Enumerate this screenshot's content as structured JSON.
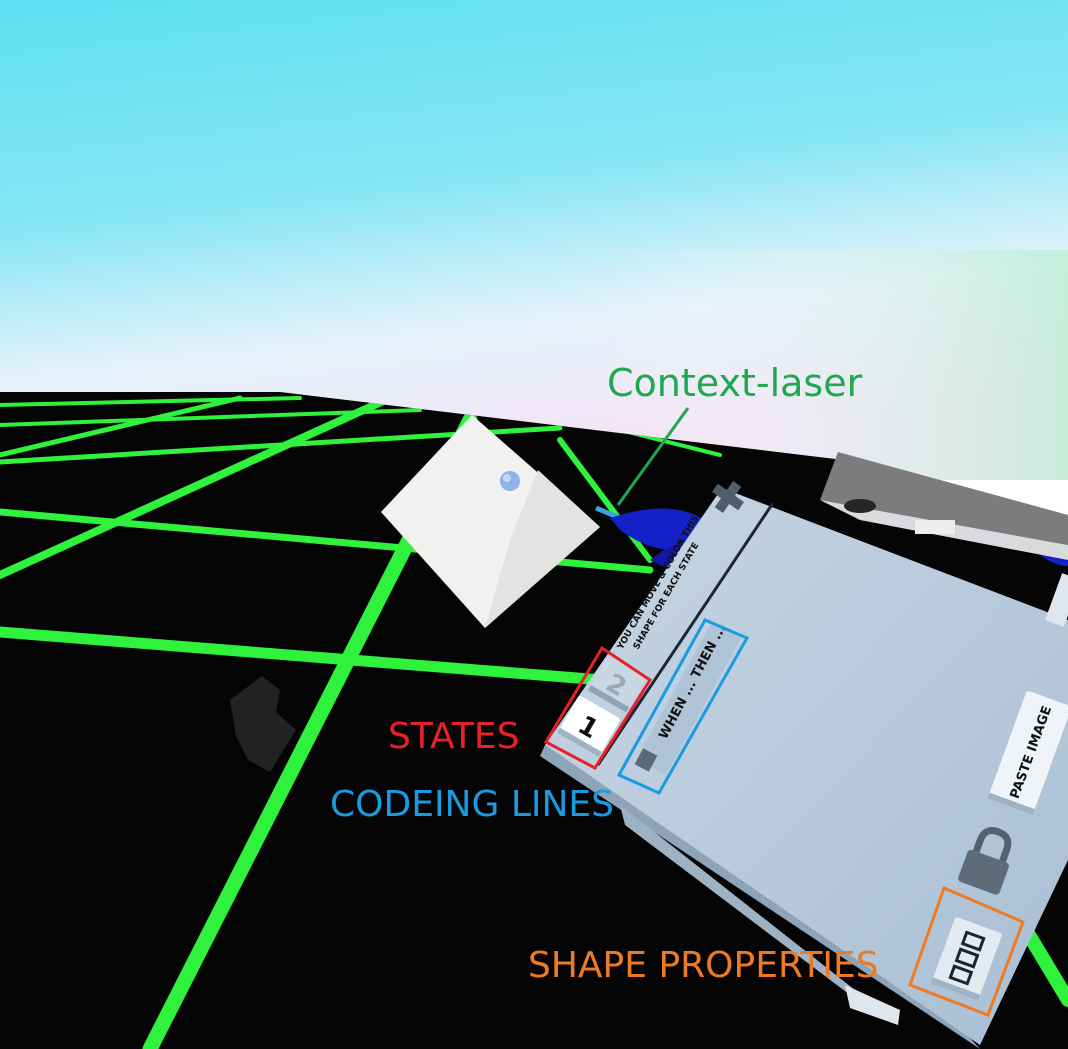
{
  "annotations": {
    "context_laser": "Context-laser",
    "states": "STATES",
    "coding_lines": "CODEING LINES",
    "shape_properties": "SHAPE PROPERTIES"
  },
  "panel": {
    "hint_line1": "YOU CAN MOVE & COLOR THIS",
    "hint_line2": "SHAPE FOR EACH STATE",
    "state_1": "1",
    "state_2": "2",
    "code_line": "WHEN ... THEN ...",
    "paste_button": "PASTE IMAGE"
  },
  "colors": {
    "grid": "#2ef23c",
    "laser_label": "#1fa84f",
    "states": "#e8202a",
    "coding_lines": "#1a9be0",
    "shape_properties": "#f07a22",
    "panel": "#b3c8dc"
  }
}
